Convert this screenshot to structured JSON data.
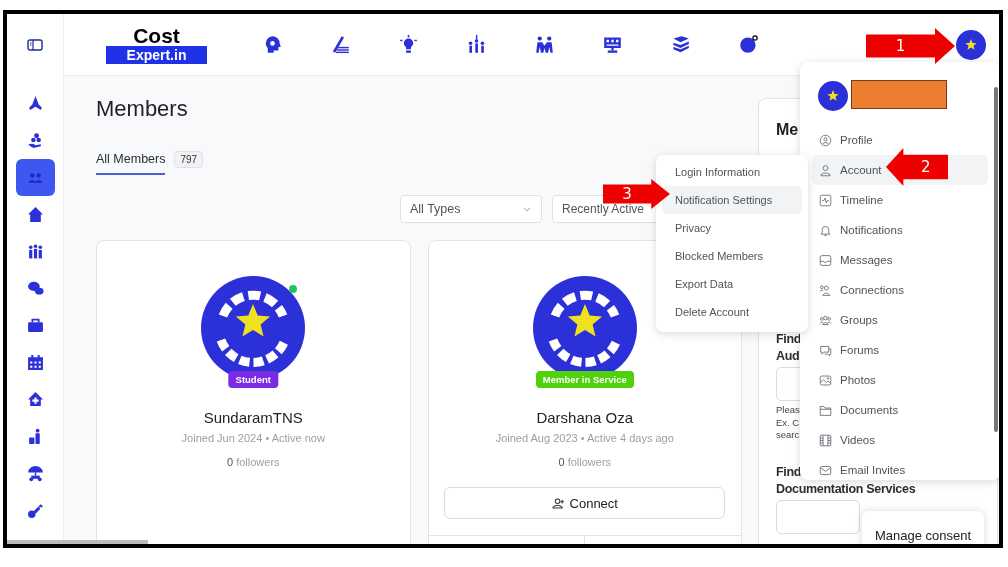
{
  "logo": {
    "line1": "Cost",
    "line2": "Expert.in"
  },
  "sidebar": {
    "items": [
      {
        "selected": false
      },
      {
        "selected": false
      },
      {
        "selected": true
      },
      {
        "selected": false
      },
      {
        "selected": false
      },
      {
        "selected": false
      },
      {
        "selected": false
      },
      {
        "selected": false
      },
      {
        "selected": false
      },
      {
        "selected": false
      },
      {
        "selected": false
      },
      {
        "selected": false
      }
    ]
  },
  "page": {
    "title": "Members"
  },
  "tabs": [
    {
      "label": "All Members",
      "count": "797",
      "selected": true
    }
  ],
  "filters": [
    {
      "value": "All Types",
      "caret": true
    },
    {
      "value": "Recently Active"
    }
  ],
  "members": [
    {
      "name": "SundaramTNS",
      "badge": "Student",
      "color": "#7b2be3",
      "online": true,
      "meta": "Joined Jun 2024 • Active now",
      "followers_count": "0",
      "followers_label": "followers"
    },
    {
      "name": "Darshana Oza",
      "badge": "Member in Service",
      "color": "#4fd10c",
      "online": false,
      "meta": "Joined Aug 2023 • Active 4 days ago",
      "followers_count": "0",
      "followers_label": "followers",
      "button": "Connect"
    }
  ],
  "widget": {
    "title": "Me",
    "sections": [
      {
        "heading": [
          "Find",
          "Aud"
        ],
        "help": [
          "Pleas",
          "Ex. C",
          "searc"
        ]
      },
      {
        "heading": [
          "Find",
          "Documentation Services"
        ]
      }
    ]
  },
  "account_menu": {
    "items": [
      {
        "label": "Profile",
        "selected": false
      },
      {
        "label": "Account",
        "selected": true
      },
      {
        "label": "Timeline",
        "selected": false
      },
      {
        "label": "Notifications",
        "selected": false
      },
      {
        "label": "Messages",
        "selected": false
      },
      {
        "label": "Connections",
        "selected": false
      },
      {
        "label": "Groups",
        "selected": false
      },
      {
        "label": "Forums",
        "selected": false
      },
      {
        "label": "Photos",
        "selected": false
      },
      {
        "label": "Documents",
        "selected": false
      },
      {
        "label": "Videos",
        "selected": false
      },
      {
        "label": "Email Invites",
        "selected": false
      }
    ]
  },
  "submenu": {
    "items": [
      {
        "label": "Login Information",
        "selected": false
      },
      {
        "label": "Notification Settings",
        "selected": true
      },
      {
        "label": "Privacy",
        "selected": false
      },
      {
        "label": "Blocked Members",
        "selected": false
      },
      {
        "label": "Export Data",
        "selected": false
      },
      {
        "label": "Delete Account",
        "selected": false
      }
    ]
  },
  "consent_button": "Manage consent",
  "annotations": [
    {
      "number": "1",
      "kind": "right"
    },
    {
      "number": "2",
      "kind": "left"
    },
    {
      "number": "3",
      "kind": "right"
    }
  ]
}
